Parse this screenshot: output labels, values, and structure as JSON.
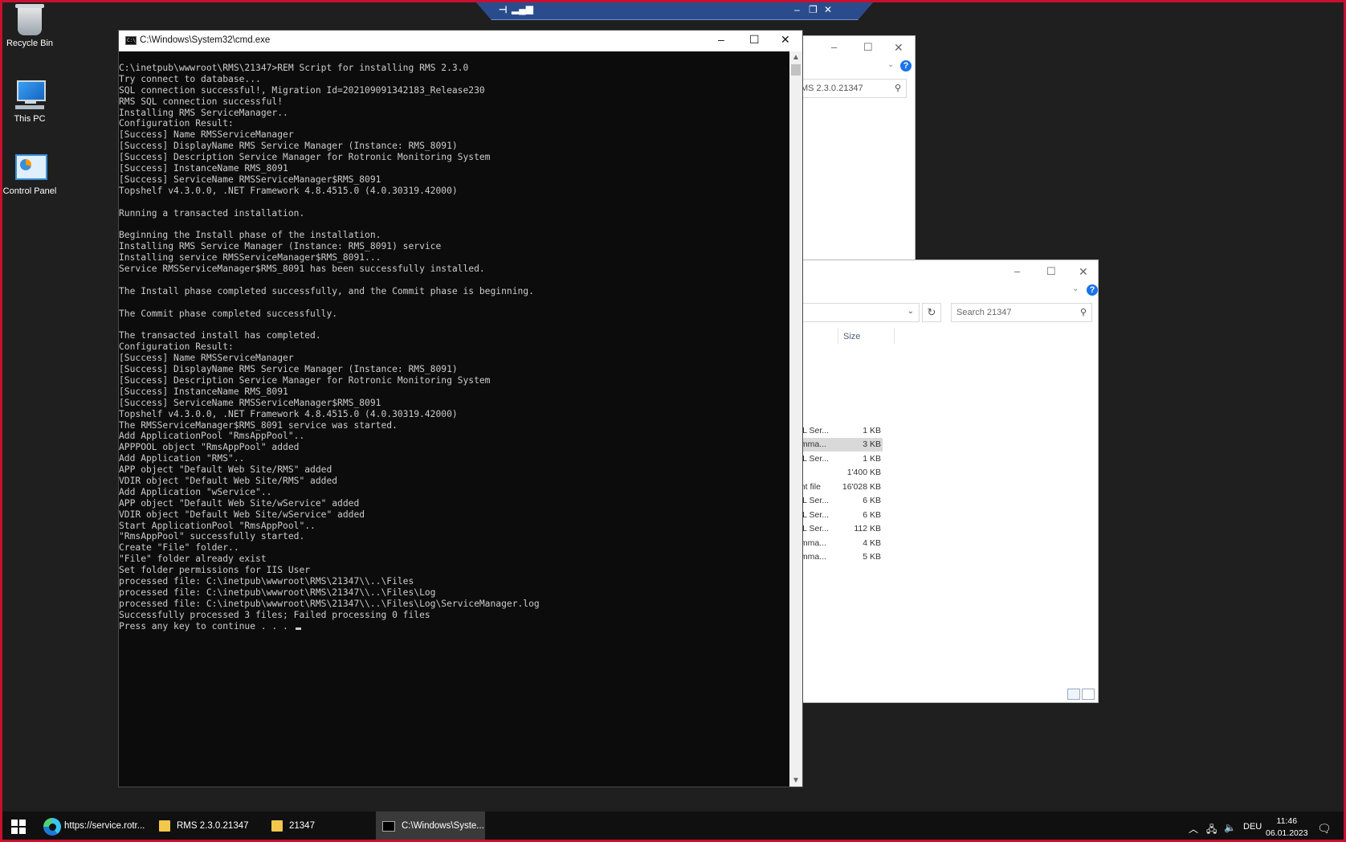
{
  "desktop": {
    "icons": [
      {
        "label": "Recycle Bin"
      },
      {
        "label": "This PC"
      },
      {
        "label": "Control Panel"
      }
    ]
  },
  "explorer_back": {
    "search_text": "MS 2.3.0.21347"
  },
  "explorer_front": {
    "search_placeholder": "Search 21347",
    "size_header": "Size",
    "rows": [
      {
        "type": "QL Ser...",
        "size": "1 KB"
      },
      {
        "type": "omma...",
        "size": "3 KB",
        "selected": true
      },
      {
        "type": "QL Ser...",
        "size": "1 KB"
      },
      {
        "type": "",
        "size": "1'400 KB"
      },
      {
        "type": "ont file",
        "size": "16'028 KB"
      },
      {
        "type": "QL Ser...",
        "size": "6 KB"
      },
      {
        "type": "QL Ser...",
        "size": "6 KB"
      },
      {
        "type": "QL Ser...",
        "size": "112 KB"
      },
      {
        "type": "omma...",
        "size": "4 KB"
      },
      {
        "type": "omma...",
        "size": "5 KB"
      }
    ]
  },
  "cmd": {
    "title": "C:\\Windows\\System32\\cmd.exe",
    "icon_text": "C:\\",
    "lines": [
      "C:\\inetpub\\wwwroot\\RMS\\21347>REM Script for installing RMS 2.3.0",
      "Try connect to database...",
      "SQL connection successful!, Migration Id=202109091342183_Release230",
      "RMS SQL connection successful!",
      "Installing RMS ServiceManager..",
      "Configuration Result:",
      "[Success] Name RMSServiceManager",
      "[Success] DisplayName RMS Service Manager (Instance: RMS_8091)",
      "[Success] Description Service Manager for Rotronic Monitoring System",
      "[Success] InstanceName RMS_8091",
      "[Success] ServiceName RMSServiceManager$RMS_8091",
      "Topshelf v4.3.0.0, .NET Framework 4.8.4515.0 (4.0.30319.42000)",
      "",
      "Running a transacted installation.",
      "",
      "Beginning the Install phase of the installation.",
      "Installing RMS Service Manager (Instance: RMS_8091) service",
      "Installing service RMSServiceManager$RMS_8091...",
      "Service RMSServiceManager$RMS_8091 has been successfully installed.",
      "",
      "The Install phase completed successfully, and the Commit phase is beginning.",
      "",
      "The Commit phase completed successfully.",
      "",
      "The transacted install has completed.",
      "Configuration Result:",
      "[Success] Name RMSServiceManager",
      "[Success] DisplayName RMS Service Manager (Instance: RMS_8091)",
      "[Success] Description Service Manager for Rotronic Monitoring System",
      "[Success] InstanceName RMS_8091",
      "[Success] ServiceName RMSServiceManager$RMS_8091",
      "Topshelf v4.3.0.0, .NET Framework 4.8.4515.0 (4.0.30319.42000)",
      "The RMSServiceManager$RMS_8091 service was started.",
      "Add ApplicationPool \"RmsAppPool\"..",
      "APPPOOL object \"RmsAppPool\" added",
      "Add Application \"RMS\"..",
      "APP object \"Default Web Site/RMS\" added",
      "VDIR object \"Default Web Site/RMS\" added",
      "Add Application \"wService\"..",
      "APP object \"Default Web Site/wService\" added",
      "VDIR object \"Default Web Site/wService\" added",
      "Start ApplicationPool \"RmsAppPool\"..",
      "\"RmsAppPool\" successfully started.",
      "Create \"File\" folder..",
      "\"File\" folder already exist",
      "Set folder permissions for IIS User",
      "processed file: C:\\inetpub\\wwwroot\\RMS\\21347\\\\..\\Files",
      "processed file: C:\\inetpub\\wwwroot\\RMS\\21347\\\\..\\Files\\Log",
      "processed file: C:\\inetpub\\wwwroot\\RMS\\21347\\\\..\\Files\\Log\\ServiceManager.log",
      "Successfully processed 3 files; Failed processing 0 files",
      "Press any key to continue . . . "
    ]
  },
  "taskbar": {
    "items": [
      {
        "label": "https://service.rotr..."
      },
      {
        "label": "RMS 2.3.0.21347"
      },
      {
        "label": "21347"
      },
      {
        "label": "C:\\Windows\\Syste..."
      }
    ],
    "language": "DEU",
    "time": "11:46",
    "date": "06.01.2023"
  },
  "colors": {
    "frame_border": "#c8102e",
    "remote_bar": "#2a4c8c",
    "console_bg": "#0c0c0c",
    "console_text": "#cccccc",
    "taskbar_bg": "#101010"
  }
}
